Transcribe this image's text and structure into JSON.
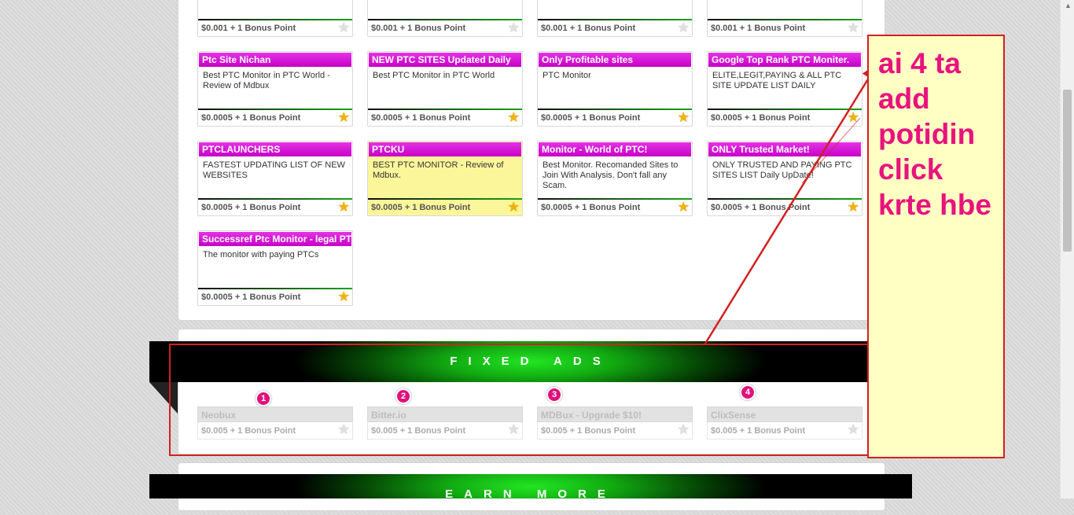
{
  "top_row_footers": [
    "$0.001 + 1 Bonus Point",
    "$0.001 + 1 Bonus Point",
    "$0.001 + 1 Bonus Point",
    "$0.001 + 1 Bonus Point"
  ],
  "ads": [
    {
      "title": "Ptc Site Nichan",
      "desc": "Best PTC Monitor in PTC World - Review of Mdbux",
      "reward": "$0.0005 + 1 Bonus Point"
    },
    {
      "title": "NEW PTC SITES Updated Daily",
      "desc": "Best PTC Monitor in PTC World",
      "reward": "$0.0005 + 1 Bonus Point"
    },
    {
      "title": "Only Profitable sites",
      "desc": "PTC Monitor",
      "reward": "$0.0005 + 1 Bonus Point"
    },
    {
      "title": "Google Top Rank PTC Moniter.",
      "desc": "ELITE,LEGIT,PAYING & ALL PTC SITE UPDATE LIST DAILY",
      "reward": "$0.0005 + 1 Bonus Point"
    },
    {
      "title": "PTCLAUNCHERS",
      "desc": "FASTEST UPDATING LIST OF NEW WEBSITES",
      "reward": "$0.0005 + 1 Bonus Point"
    },
    {
      "title": "PTCKU",
      "desc": "BEST PTC MONITOR - Review of Mdbux.",
      "reward": "$0.0005 + 1 Bonus Point"
    },
    {
      "title": "Monitor - World of PTC!",
      "desc": "Best Monitor. Recomanded Sites to Join With Analysis. Don't fall any Scam.",
      "reward": "$0.0005 + 1 Bonus Point"
    },
    {
      "title": "ONLY Trusted Market!",
      "desc": "ONLY TRUSTED AND PAYING PTC SITES LIST Daily UpDate!",
      "reward": "$0.0005 + 1 Bonus Point"
    },
    {
      "title": "Successref Ptc Monitor - legal PTC",
      "desc": "The monitor with paying PTCs",
      "reward": "$0.0005 + 1 Bonus Point"
    }
  ],
  "fixed_ads": {
    "heading": "FIXED ADS",
    "items": [
      {
        "title": "Neobux",
        "reward": "$0.005 + 1 Bonus Point",
        "badge": "1"
      },
      {
        "title": "Bitter.io",
        "reward": "$0.005 + 1 Bonus Point",
        "badge": "2"
      },
      {
        "title": "MDBux - Upgrade $10!",
        "reward": "$0.005 + 1 Bonus Point",
        "badge": "3"
      },
      {
        "title": "ClixSense",
        "reward": "$0.005 + 1 Bonus Point",
        "badge": "4"
      }
    ]
  },
  "earn_more": {
    "heading": "EARN MORE"
  },
  "annotation": {
    "text": "ai 4 ta add potidin click krte hbe"
  },
  "colors": {
    "accent_title": "#d100d1",
    "highlight": "#fcf69a",
    "note_text": "#e8137e",
    "band_green": "#22e622"
  }
}
